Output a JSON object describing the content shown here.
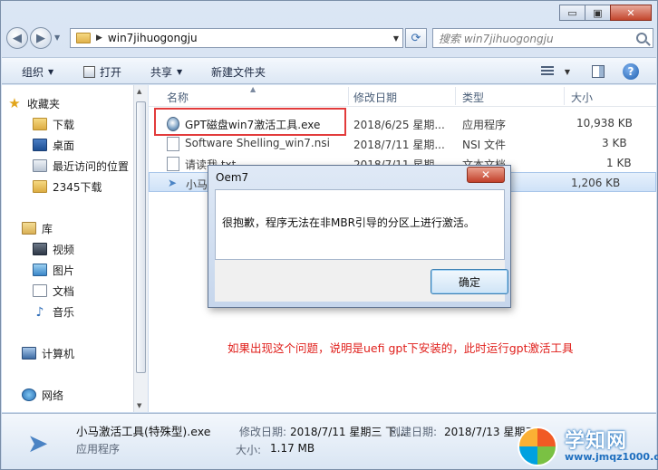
{
  "window": {
    "caption_minimize": "▭",
    "caption_maximize": "▣",
    "caption_close": "✕"
  },
  "address_bar": {
    "path": "win7jihuogongju",
    "search_placeholder": "搜索 win7jihuogongju"
  },
  "toolbar": {
    "organize": "组织",
    "open": "打开",
    "share": "共享",
    "new_folder": "新建文件夹"
  },
  "sidebar": {
    "items": [
      {
        "label": "收藏夹",
        "icon": "star-icon"
      },
      {
        "label": "下载",
        "icon": "downloads-folder-icon"
      },
      {
        "label": "桌面",
        "icon": "desktop-icon"
      },
      {
        "label": "最近访问的位置",
        "icon": "recent-places-icon"
      },
      {
        "label": "2345下载",
        "icon": "folder-icon"
      },
      {
        "label": "库",
        "icon": "library-icon"
      },
      {
        "label": "视频",
        "icon": "video-icon"
      },
      {
        "label": "图片",
        "icon": "pictures-icon"
      },
      {
        "label": "文档",
        "icon": "documents-icon"
      },
      {
        "label": "音乐",
        "icon": "music-icon"
      },
      {
        "label": "计算机",
        "icon": "computer-icon"
      },
      {
        "label": "网络",
        "icon": "network-icon"
      }
    ]
  },
  "file_list": {
    "columns": [
      "名称",
      "修改日期",
      "类型",
      "大小"
    ],
    "rows": [
      {
        "name": "GPT磁盘win7激活工具.exe",
        "date": "2018/6/25 星期...",
        "type": "应用程序",
        "size": "10,938 KB",
        "icon": "exe-app-icon"
      },
      {
        "name": "Software Shelling_win7.nsi",
        "date": "2018/7/11 星期...",
        "type": "NSI 文件",
        "size": "3 KB",
        "icon": "document-icon"
      },
      {
        "name": "请读我.txt",
        "date": "2018/7/11 星期...",
        "type": "文本文档",
        "size": "1 KB",
        "icon": "text-file-icon"
      },
      {
        "name": "小马",
        "date": "",
        "type": "",
        "size": "1,206 KB",
        "icon": "paper-plane-icon"
      }
    ]
  },
  "dialog": {
    "title": "Oem7",
    "close": "✕",
    "message": "很抱歉，程序无法在非MBR引导的分区上进行激活。",
    "ok_label": "确定"
  },
  "annotation": "如果出现这个问题，说明是uefi gpt下安装的，此时运行gpt激活工具",
  "details": {
    "file_name": "小马激活工具(特殊型).exe",
    "file_type": "应用程序",
    "modified_label": "修改日期:",
    "modified_value": "2018/7/11 星期三 下...",
    "created_label": "创建日期:",
    "created_value": "2018/7/13 星期五",
    "size_label": "大小:",
    "size_value": "1.17 MB"
  },
  "watermark": {
    "title": "学知网",
    "url": "www.jmqz1000.com"
  },
  "colors": {
    "highlight_red": "#e23b3b",
    "annotation_red": "#e0201c",
    "selection_blue": "#cfe2f8"
  }
}
